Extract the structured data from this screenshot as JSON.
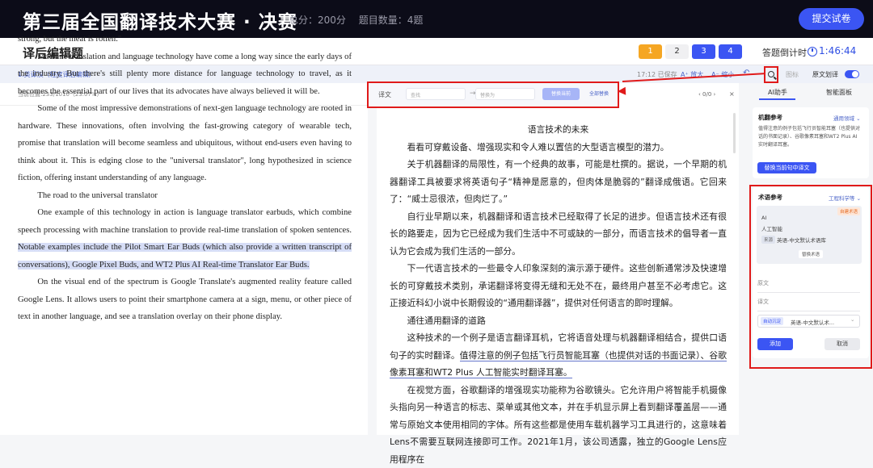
{
  "header": {
    "title": "第三届全国翻译技术大赛 · 决赛",
    "total_score": "总分：200分",
    "question_count": "题目数量：4题",
    "submit_label": "提交试卷"
  },
  "subheader": {
    "title": "译后编辑题",
    "question_numbers": [
      "1",
      "2",
      "3",
      "4"
    ],
    "active_question": "1",
    "countdown_label": "答题倒计时",
    "countdown_value": "1:46:44"
  },
  "toolbar": {
    "task_label": "1.英译汉（轻度译后编辑）",
    "saved": "17:12 已保存",
    "zoom_in": "A⁺ 放大",
    "zoom_out": "A⁻ 缩小",
    "undo": "↶",
    "glossary": "图标",
    "source_underline": "原文划译"
  },
  "source": {
    "position": "当前位置:233/1010（23.07%）",
    "paragraphs": [
      "strong, but the meat is rotten.\"",
      "Machine translation and language technology have come a long way since the early days of the industry. But there's still plenty more distance for language technology to travel, as it becomes the essential part of our lives that its advocates have always believed it will be.",
      "Some of the most impressive demonstrations of next-gen language technology are rooted in hardware. These innovations, often involving the fast-growing category of wearable tech, promise that translation will become seamless and ubiquitous, without end-users even having to think about it. This is edging close to the \"universal translator\", long hypothesized in science fiction, offering instant understanding of any language.",
      "The road to the universal translator"
    ],
    "para5_plain": "One example of this technology in action is language translator earbuds, which combine speech processing with machine translation to provide real-time translation of spoken sentences.",
    "para5_highlight": "Notable examples include the Pilot Smart Ear Buds (which also provide a written transcript of conversations), Google Pixel Buds, and WT2 Plus AI Real-time Translator Ear Buds.",
    "para6": "On the visual end of the spectrum is Google Translate's augmented reality feature called Google Lens. It allows users to point their smartphone camera at a sign, menu, or other piece of text in another language, and see a translation overlay on their phone display."
  },
  "findbar": {
    "label": "译文",
    "find_placeholder": "查找",
    "replace_placeholder": "替换为",
    "replace_current": "替换当前",
    "replace_all": "全部替换",
    "count": "‹ 0/0 ›",
    "close": "×"
  },
  "target": {
    "heading": "语言技术的未来",
    "paragraphs": [
      "看看可穿戴设备、增强现实和令人难以置信的大型语言模型的潜力。",
      "关于机器翻译的局限性，有一个经典的故事，可能是杜撰的。据说，一个早期的机器翻译工具被要求将英语句子“精神是愿意的，但肉体是脆弱的”翻译成俄语。它回来了：“威士忌很浓，但肉烂了。”",
      "自行业早期以来，机器翻译和语言技术已经取得了长足的进步。但语言技术还有很长的路要走，因为它已经成为我们生活中不可或缺的一部分，而语言技术的倡导者一直认为它会成为我们生活的一部分。",
      "下一代语言技术的一些最令人印象深刻的演示源于硬件。这些创新通常涉及快速增长的可穿戴技术类别，承诺翻译将变得无缝和无处不在，最终用户甚至不必考虑它。这正接近科幻小说中长期假设的“通用翻译器”，提供对任何语言的即时理解。",
      "通往通用翻译的道路"
    ],
    "para6_plain": "这种技术的一个例子是语言翻译耳机，它将语音处理与机器翻译相结合，提供口语句子的实时翻译。",
    "para6_underlined": "值得注意的例子包括飞行员智能耳塞（也提供对话的书面记录）、谷歌像素耳塞和WT2 Plus 人工智能实时翻译耳塞。",
    "para7": "在视觉方面，谷歌翻译的增强现实功能称为谷歌镜头。它允许用户将智能手机摄像头指向另一种语言的标志、菜单或其他文本，并在手机显示屏上看到翻译覆盖层——通常与原始文本使用相同的字体。所有这些都是使用车载机器学习工具进行的，这意味着Lens不需要互联网连接即可工作。2021年1月，该公司透露，独立的Google Lens应用程序在"
  },
  "right_panel": {
    "tabs": [
      "AI助手",
      "智能面板"
    ],
    "mt": {
      "title": "机翻参考",
      "domain_link": "通用领域 ⌄",
      "text": "值得注意的例子包括飞行员智能耳塞（也提供对话的书面记录）、谷歌像素耳塞和WT2 Plus AI实时翻译耳塞。",
      "replace_button": "替换当前句中译文"
    },
    "term": {
      "title": "术语参考",
      "domain_link": "工程科学等 ⌄",
      "auto_tag": "自建术语",
      "source_term": "AI",
      "target_term": "人工智能",
      "lib_tag": "来源",
      "lib_name": "英语-中文默认术语库",
      "replace_button": "替换术语"
    },
    "form": {
      "source_label": "原文",
      "target_label": "译文",
      "auto_tag": "自动沉淀",
      "library": "英语-中文默认术...",
      "add_button": "添加",
      "cancel_button": "取消"
    }
  }
}
